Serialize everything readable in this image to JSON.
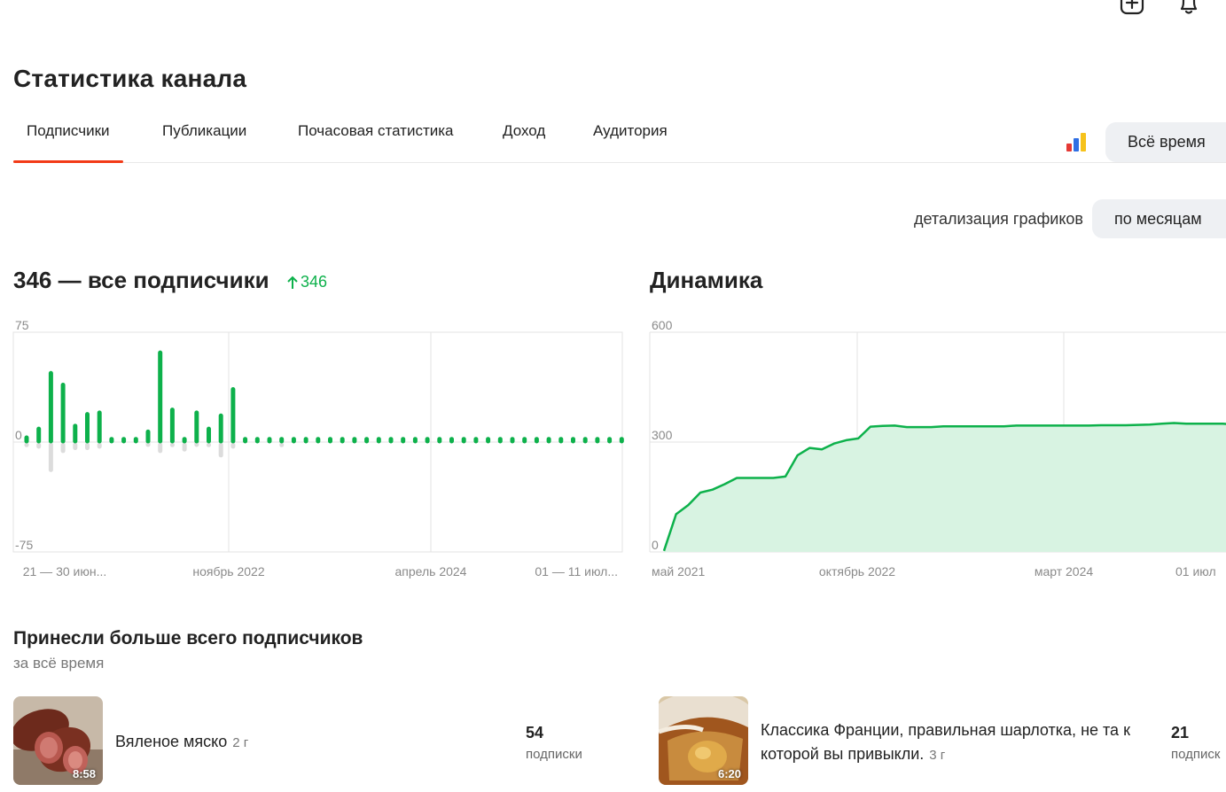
{
  "page_title": "Статистика канала",
  "tabs": [
    {
      "label": "Подписчики",
      "active": true
    },
    {
      "label": "Публикации",
      "active": false
    },
    {
      "label": "Почасовая статистика",
      "active": false
    },
    {
      "label": "Доход",
      "active": false
    },
    {
      "label": "Аудитория",
      "active": false
    }
  ],
  "period": {
    "label": "Всё время"
  },
  "detail": {
    "label": "детализация графиков",
    "value": "по месяцам"
  },
  "subscribers": {
    "title": "346 — все подписчики",
    "growth": "346"
  },
  "dynamics": {
    "title": "Динамика"
  },
  "colors": {
    "accent": "#f23a17",
    "positive": "#0db14b",
    "negative": "#dcdcdc",
    "area_fill": "#d8f3e2"
  },
  "chart_data": [
    {
      "type": "bar",
      "y_ticks": [
        "75",
        "0",
        "-75"
      ],
      "ylim": [
        -75,
        75
      ],
      "x_labels": [
        "21 — 30 июн...",
        "ноябрь 2022",
        "апрель 2024",
        "01 — 11 июл..."
      ],
      "series": [
        {
          "values": [
            3,
            9,
            47,
            39,
            11,
            19,
            20,
            2,
            2,
            2,
            7,
            61,
            22,
            2,
            20,
            9,
            18,
            36,
            2,
            2,
            2,
            2,
            2,
            2,
            2,
            2,
            2,
            2,
            2,
            2,
            2,
            2,
            2,
            2,
            2,
            2,
            2,
            2,
            2,
            2,
            2,
            2,
            2,
            2,
            2,
            2,
            2,
            2,
            2,
            2
          ]
        },
        {
          "values": [
            -2,
            -3,
            -19,
            -6,
            -4,
            -4,
            -3,
            0,
            0,
            0,
            -1,
            -6,
            -2,
            -5,
            -1,
            -2,
            -9,
            -3,
            0,
            0,
            0,
            -2,
            0,
            0,
            0,
            0,
            0,
            0,
            0,
            0,
            0,
            0,
            0,
            0,
            0,
            0,
            0,
            0,
            0,
            0,
            0,
            0,
            0,
            0,
            0,
            0,
            0,
            0,
            0,
            0
          ]
        }
      ]
    },
    {
      "type": "area",
      "y_ticks": [
        "600",
        "300",
        "0"
      ],
      "ylim": [
        0,
        600
      ],
      "x_labels": [
        "май 2021",
        "октябрь 2022",
        "март 2024",
        "01 июл"
      ],
      "x": [
        "2021-05",
        "2021-06",
        "2021-07",
        "2021-08",
        "2021-09",
        "2021-10",
        "2021-11",
        "2021-12",
        "2022-01",
        "2022-02",
        "2022-03",
        "2022-04",
        "2022-05",
        "2022-06",
        "2022-07",
        "2022-08",
        "2022-09",
        "2022-10",
        "2022-11",
        "2022-12",
        "2023-01",
        "2023-02",
        "2023-03",
        "2023-04",
        "2023-05",
        "2023-06",
        "2023-07",
        "2023-08",
        "2023-09",
        "2023-10",
        "2023-11",
        "2023-12",
        "2024-01",
        "2024-02",
        "2024-03",
        "2024-04",
        "2024-05",
        "2024-06",
        "2024-07",
        "2024-08",
        "2024-09",
        "2024-10",
        "2024-11",
        "2024-12",
        "2025-01",
        "2025-02",
        "2025-03",
        "2025-04",
        "2025-05",
        "2025-06",
        "2025-07"
      ],
      "values": [
        3,
        103,
        128,
        162,
        170,
        185,
        202,
        202,
        202,
        202,
        206,
        264,
        284,
        280,
        296,
        305,
        310,
        342,
        344,
        345,
        341,
        341,
        341,
        343,
        343,
        343,
        343,
        343,
        343,
        345,
        345,
        345,
        345,
        345,
        345,
        345,
        346,
        346,
        346,
        347,
        348,
        350,
        352,
        350,
        350,
        350,
        350,
        348,
        348,
        349,
        349
      ]
    }
  ],
  "top_section": {
    "title": "Принесли больше всего подписчиков",
    "caption": "за всё время"
  },
  "top_items": [
    {
      "title": "Вяленое мяско",
      "age": "2 г",
      "duration": "8:58",
      "count": "54",
      "unit": "подписки"
    },
    {
      "title": "Классика Франции, правильная шарлотка, не та к которой вы привыкли.",
      "age": "3 г",
      "duration": "6:20",
      "count": "21",
      "unit": "подписк"
    }
  ]
}
